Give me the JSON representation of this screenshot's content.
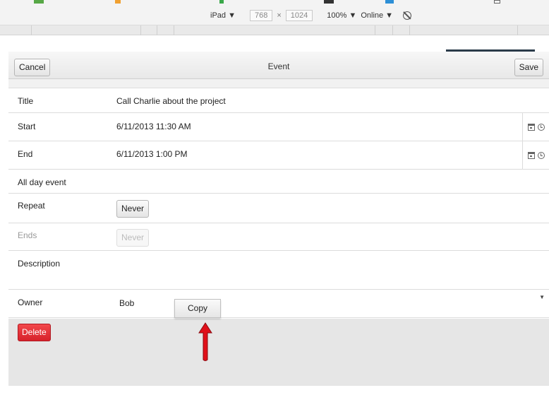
{
  "devtools": {
    "device": "iPad ▼",
    "width": "768",
    "times": "×",
    "height": "1024",
    "zoom": "100% ▼",
    "network": "Online ▼"
  },
  "header": {
    "cancel_label": "Cancel",
    "title": "Event",
    "save_label": "Save"
  },
  "form": {
    "title": {
      "label": "Title",
      "value": "Call Charlie about the project"
    },
    "start": {
      "label": "Start",
      "value": "6/11/2013 11:30 AM"
    },
    "end": {
      "label": "End",
      "value": "6/11/2013 1:00 PM"
    },
    "all_day": {
      "label": "All day event"
    },
    "repeat": {
      "label": "Repeat",
      "value": "Never"
    },
    "ends": {
      "label": "Ends",
      "value": "Never"
    },
    "description": {
      "label": "Description"
    },
    "owner": {
      "label": "Owner",
      "value": "Bob"
    }
  },
  "context_menu": {
    "copy_label": "Copy"
  },
  "actions": {
    "delete_label": "Delete"
  },
  "colors": {
    "delete": "#e0262f",
    "arrow": "#e0101a"
  }
}
